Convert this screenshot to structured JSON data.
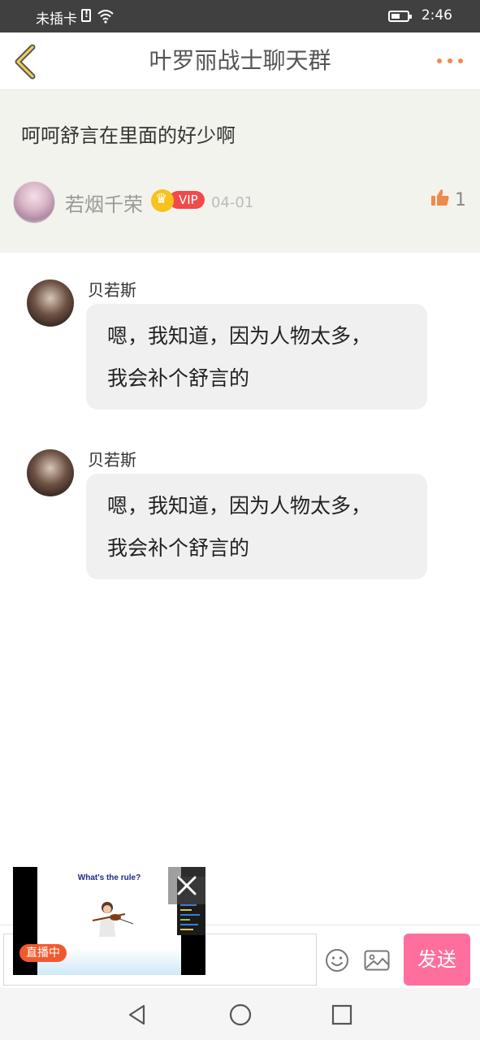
{
  "status_bar": {
    "carrier": "未插卡",
    "time": "2:46"
  },
  "header": {
    "title": "叶罗丽战士聊天群",
    "accent": "#f08a4b"
  },
  "post": {
    "text": "呵呵舒言在里面的好少啊",
    "author": "若烟千荣",
    "vip": "VIP",
    "date": "04-01",
    "likes": "1"
  },
  "messages": [
    {
      "sender": "贝若斯",
      "line1": "嗯，我知道，因为人物太多，",
      "line2": "我会补个舒言的"
    },
    {
      "sender": "贝若斯",
      "line1": "嗯，我知道，因为人物太多，",
      "line2": "我会补个舒言的"
    }
  ],
  "composer": {
    "send_label": "发送",
    "send_color": "#ff6f9e"
  },
  "live_video": {
    "slide_title": "What's the rule?",
    "badge": "直播中"
  },
  "icons": [
    "back-icon",
    "more-icon",
    "crown-icon",
    "thumb-up-icon",
    "emoji-icon",
    "image-icon",
    "close-icon",
    "nav-back-icon",
    "nav-home-icon",
    "nav-recent-icon"
  ]
}
